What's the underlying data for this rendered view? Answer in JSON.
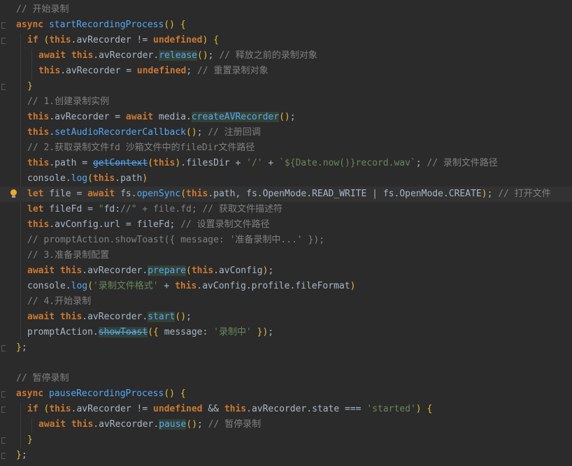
{
  "editor": {
    "lines": [
      {
        "indent": 0,
        "text": "// 开始录制"
      },
      {
        "indent": 0,
        "text": "async startRecordingProcess() {"
      },
      {
        "indent": 1,
        "text": "if (this.avRecorder != undefined) {"
      },
      {
        "indent": 2,
        "text": "await this.avRecorder.release(); // 释放之前的录制对象"
      },
      {
        "indent": 2,
        "text": "this.avRecorder = undefined; // 重置录制对象"
      },
      {
        "indent": 1,
        "text": "}"
      },
      {
        "indent": 1,
        "text": "// 1.创建录制实例"
      },
      {
        "indent": 1,
        "text": "this.avRecorder = await media.createAVRecorder();"
      },
      {
        "indent": 1,
        "text": "this.setAudioRecorderCallback(); // 注册回调"
      },
      {
        "indent": 1,
        "text": "// 2.获取录制文件fd 沙箱文件中的fileDir文件路径"
      },
      {
        "indent": 1,
        "text": "this.path = getContext(this).filesDir + '/' + `${Date.now()}record.wav`; // 录制文件路径"
      },
      {
        "indent": 1,
        "text": "console.log(this.path)"
      },
      {
        "indent": 1,
        "text": "let file = await fs.openSync(this.path, fs.OpenMode.READ_WRITE | fs.OpenMode.CREATE); // 打开文件"
      },
      {
        "indent": 1,
        "text": "let fileFd = \"fd://\" + file.fd; // 获取文件描述符"
      },
      {
        "indent": 1,
        "text": "this.avConfig.url = fileFd; // 设置录制文件路径"
      },
      {
        "indent": 1,
        "text": "// promptAction.showToast({ message: '准备录制中...' });"
      },
      {
        "indent": 1,
        "text": "// 3.准备录制配置"
      },
      {
        "indent": 1,
        "text": "await this.avRecorder.prepare(this.avConfig);"
      },
      {
        "indent": 1,
        "text": "console.log('录制文件格式' + this.avConfig.profile.fileFormat)"
      },
      {
        "indent": 1,
        "text": "// 4.开始录制"
      },
      {
        "indent": 1,
        "text": "await this.avRecorder.start();"
      },
      {
        "indent": 1,
        "text": "promptAction.showToast({ message: '录制中' });"
      },
      {
        "indent": 0,
        "text": "};"
      },
      {
        "indent": 0,
        "text": ""
      },
      {
        "indent": 0,
        "text": "// 暂停录制"
      },
      {
        "indent": 0,
        "text": "async pauseRecordingProcess() {"
      },
      {
        "indent": 1,
        "text": "if (this.avRecorder != undefined && this.avRecorder.state === 'started') {"
      },
      {
        "indent": 2,
        "text": "await this.avRecorder.pause(); // 暂停录制"
      },
      {
        "indent": 1,
        "text": "}"
      },
      {
        "indent": 0,
        "text": "};"
      }
    ],
    "colors": {
      "background": "#2b2b2b",
      "comment": "#808080",
      "keyword": "#cc7832",
      "function": "#56a8f5",
      "string": "#6a8759",
      "bracket": "#e8ba36",
      "text": "#a9b7c6"
    },
    "icons": {
      "intention": "lightbulb-icon",
      "fold": "fold-marker-icon"
    }
  }
}
